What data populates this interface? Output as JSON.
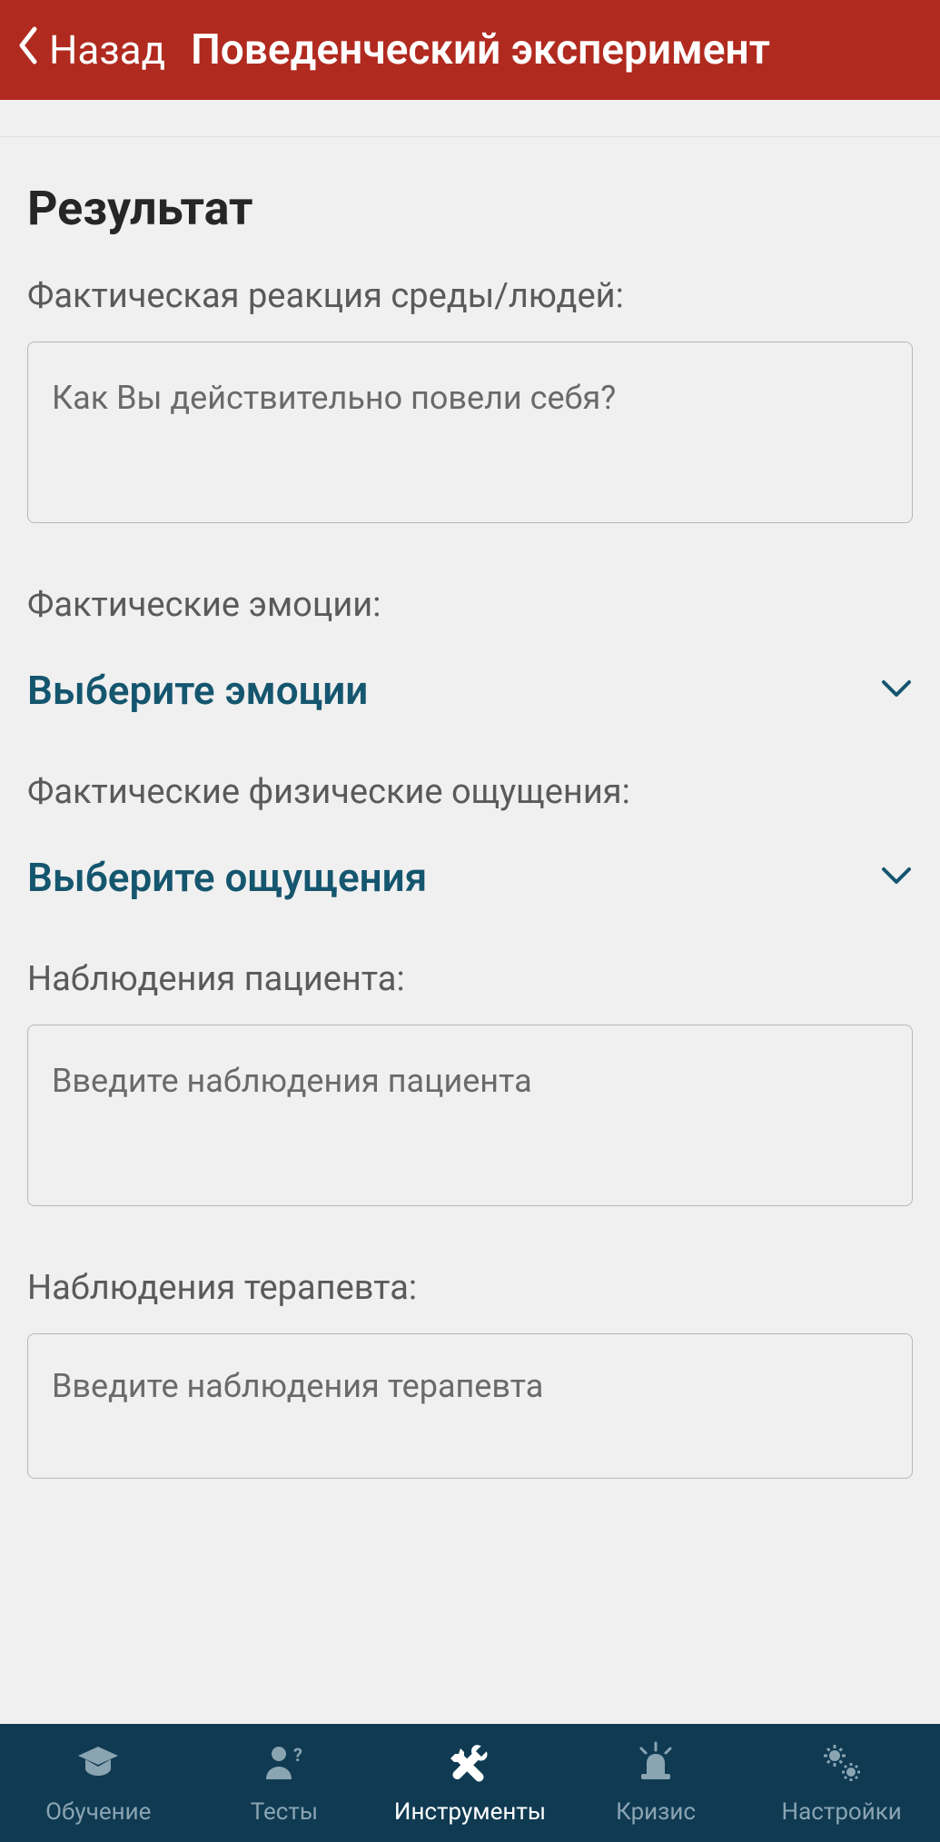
{
  "header": {
    "back_label": "Назад",
    "title": "Поведенческий эксперимент"
  },
  "section": {
    "heading": "Результат"
  },
  "fields": {
    "reaction": {
      "label": "Фактическая реакция среды/людей:",
      "placeholder": "Как Вы действительно повели себя?"
    },
    "emotions": {
      "label": "Фактические эмоции:",
      "select_text": "Выберите эмоции"
    },
    "sensations": {
      "label": "Фактические физические ощущения:",
      "select_text": "Выберите ощущения"
    },
    "patient_obs": {
      "label": "Наблюдения пациента:",
      "placeholder": "Введите наблюдения пациента"
    },
    "therapist_obs": {
      "label": "Наблюдения терапевта:",
      "placeholder": "Введите наблюдения терапевта"
    }
  },
  "tabs": {
    "learning": "Обучение",
    "tests": "Тесты",
    "tools": "Инструменты",
    "crisis": "Кризис",
    "settings": "Настройки"
  }
}
